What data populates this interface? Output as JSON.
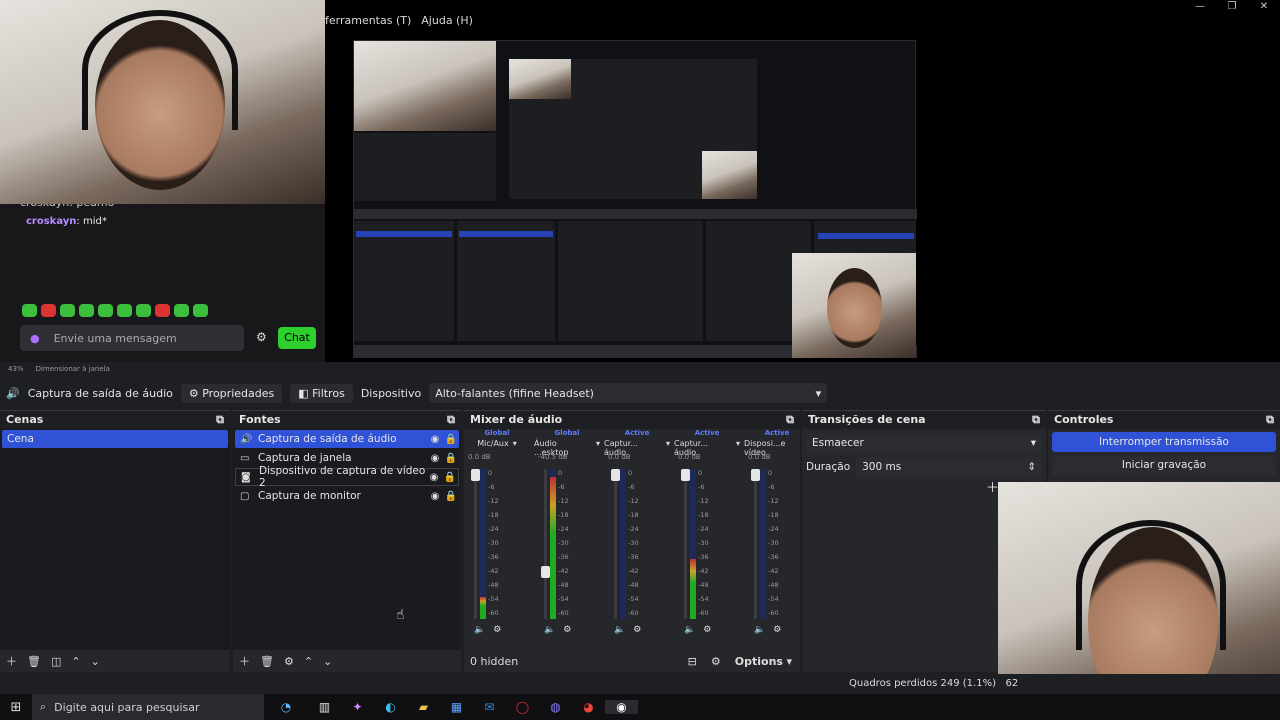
{
  "menu": {
    "items": [
      "ferramentas (T)",
      "Ajuda (H)"
    ]
  },
  "window_controls": {
    "minimize": "—",
    "restore": "❐",
    "close": "✕"
  },
  "chat": {
    "line1": "croskayn: peamo",
    "line2_user": "croskayn",
    "line2_msg": ": mid*",
    "input_placeholder": "Envie uma mensagem",
    "chat_button": "Chat"
  },
  "preview_status": {
    "zoom": "43%",
    "mode": "Dimensionar à janela"
  },
  "source_bar": {
    "source_name": "Captura de saída de áudio",
    "properties": "Propriedades",
    "filters": "Filtros",
    "device_label": "Dispositivo",
    "device_value": "Alto-falantes (fifine Headset)"
  },
  "scenes": {
    "title": "Cenas",
    "items": [
      "Cena"
    ]
  },
  "sources": {
    "title": "Fontes",
    "items": [
      "Captura de saída de áudio",
      "Captura de janela",
      "Dispositivo de captura de vídeo 2",
      "Captura de monitor"
    ]
  },
  "mixer": {
    "title": "Mixer de áudio",
    "hidden_label": "0 hidden",
    "options_label": "Options",
    "channels": [
      {
        "tag": "Global",
        "name": "Mic/Aux",
        "db": "0.0 dB",
        "level": 0.15,
        "fader": 1.0
      },
      {
        "tag": "Global",
        "name": "Áudio ...esktop",
        "db": "-40.5 dB",
        "level": 0.95,
        "fader": 0.3
      },
      {
        "tag": "Active",
        "name": "Captur... áudio",
        "db": "0.0 dB",
        "level": 0.0,
        "fader": 1.0
      },
      {
        "tag": "Active",
        "name": "Captur... áudio",
        "db": "0.0 dB",
        "level": 0.4,
        "fader": 1.0
      },
      {
        "tag": "Active",
        "name": "Disposi...e vídeo",
        "db": "0.0 dB",
        "level": 0.0,
        "fader": 1.0
      }
    ],
    "scale": [
      "0",
      "-6",
      "-12",
      "-18",
      "-24",
      "-30",
      "-36",
      "-42",
      "-48",
      "-54",
      "-60"
    ]
  },
  "transitions": {
    "title": "Transições de cena",
    "type": "Esmaecer",
    "duration_label": "Duração",
    "duration_value": "300 ms"
  },
  "controls": {
    "title": "Controles",
    "stop_stream": "Interromper transmissão",
    "start_record": "Iniciar gravação"
  },
  "status": {
    "dropped": "Quadros perdidos 249 (1.1%)",
    "cpu": "62"
  },
  "taskbar": {
    "search_placeholder": "Digite aqui para pesquisar"
  },
  "colors": {
    "accent": "#2f52d6",
    "twitch_green": "#2fce2f",
    "active_tag": "#5c7cff"
  }
}
